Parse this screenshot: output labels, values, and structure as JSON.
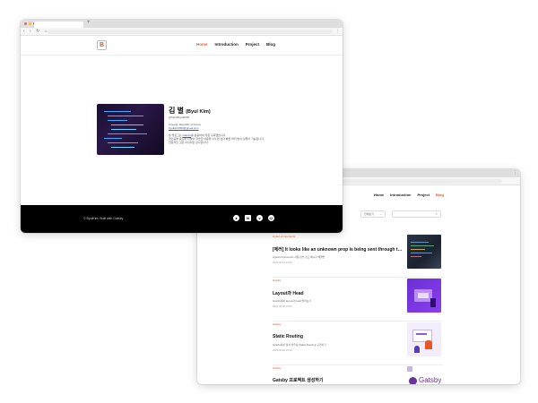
{
  "front": {
    "nav": [
      "Home",
      "Introduction",
      "Project",
      "Blog"
    ],
    "logo_letter": "B",
    "profile": {
      "name": "김 별",
      "name_en": "(Byul Kim)",
      "handle": "@hkim8byul0030",
      "location": "Anyang, Republic of Korea",
      "email": "byulkim0303@gmail.com",
      "bio_1_pre": "본 블로그는 ",
      "bio_1_link": "Gatsby",
      "bio_1_post": "를 활용하여 직접 구축했습니다.",
      "bio_2": "개인공부 용도와 더불어 학습한 내용을 나누면 보다 빠른 처리 방식 실행이 가능합니다.",
      "bio_3": "전문적인 것은 아니지만 감사합니다."
    },
    "footer": {
      "copy": "© ByulKim. Built with Gatsby",
      "icons": [
        "github-icon",
        "notion-icon",
        "velog-icon",
        "mail-icon"
      ]
    }
  },
  "back": {
    "nav": [
      "Home",
      "Introduction",
      "Project",
      "Blog"
    ],
    "select_value": "전체보기",
    "search_icon": "search-icon",
    "posts": [
      {
        "category": "styled-components",
        "title": "[에러] It looks like an unknown prop is being sent through to t...",
        "desc": "styled-components 사용 관련 경고 메시지 해결법",
        "date": "2023.02.13 12:00"
      },
      {
        "category": "Gatsby",
        "title": "Layout과 Head",
        "desc": "Gatsby에서 layout과 head 알아보기",
        "date": "2023.02.06 15:00"
      },
      {
        "category": "Gatsby",
        "title": "Static Routing",
        "desc": "Gatsby에서 정적 라우팅 (Static Routing) 구현하기",
        "date": "2023.02.03 15:12"
      },
      {
        "category": "Gatsby",
        "title": "Gatsby 프로젝트 생성하기",
        "desc": "",
        "date": ""
      }
    ],
    "thumb_text": "Gatsby"
  }
}
